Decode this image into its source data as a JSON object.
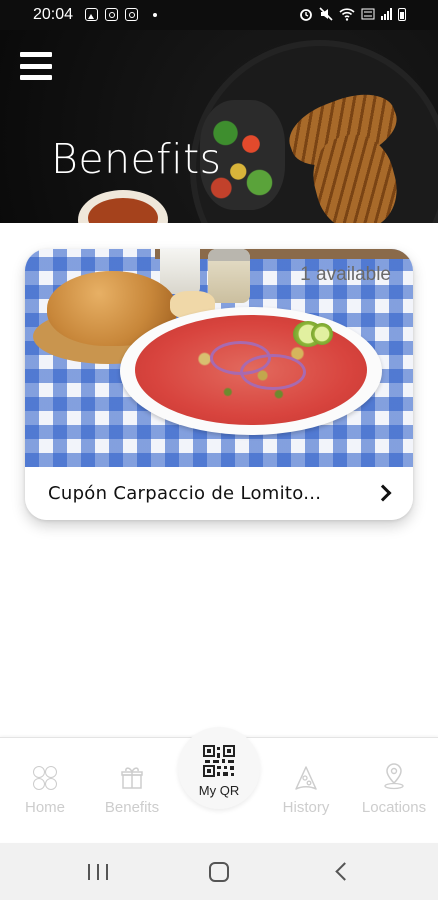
{
  "status_bar": {
    "time": "20:04",
    "left_icons": [
      "image-notification-icon",
      "instagram-icon",
      "instagram-icon"
    ],
    "right_icons": [
      "alarm-icon",
      "mute-icon",
      "wifi-icon",
      "volte-icon",
      "signal-icon",
      "battery-icon"
    ],
    "volte_text": "Vo)\nLTE"
  },
  "header": {
    "title": "Benefits",
    "menu_icon": "hamburger-menu-icon"
  },
  "coupons": [
    {
      "title": "Cupón Carpaccio de Lomito...",
      "availability": "1 available",
      "image": "carpaccio-dish-photo"
    }
  ],
  "bottom_nav": {
    "items": [
      {
        "label": "Home",
        "icon": "home-circles-icon"
      },
      {
        "label": "Benefits",
        "icon": "gift-icon"
      },
      {
        "label": "History",
        "icon": "pizza-slice-icon"
      },
      {
        "label": "Locations",
        "icon": "map-pin-icon"
      }
    ],
    "qr": {
      "label": "My QR",
      "icon": "qr-code-icon"
    }
  },
  "colors": {
    "header_bg": "#141414",
    "nav_inactive": "#cdcdcd",
    "qr_label": "#222222",
    "tablecloth_blue": "#2f5fc8"
  }
}
